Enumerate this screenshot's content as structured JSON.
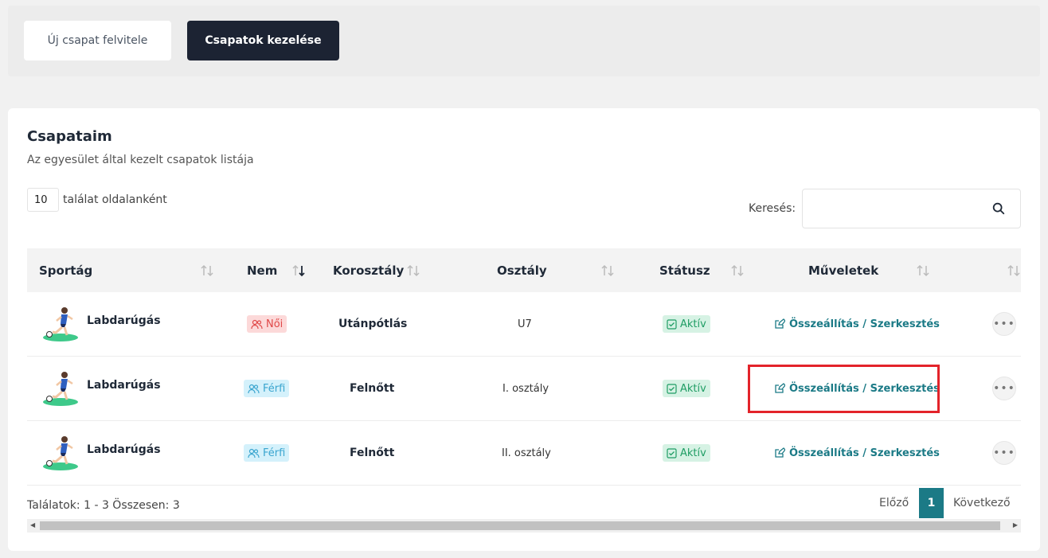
{
  "tabs": {
    "new_team": "Új csapat felvitele",
    "manage_teams": "Csapatok kezelése"
  },
  "card": {
    "title": "Csapataim",
    "subtitle": "Az egyesület által kezelt csapatok listája"
  },
  "table_controls": {
    "per_page_value": "10",
    "per_page_label": "találat oldalanként",
    "search_label": "Keresés:",
    "search_value": ""
  },
  "table": {
    "columns": [
      "Sportág",
      "Nem",
      "Korosztály",
      "Osztály",
      "Státusz",
      "Műveletek"
    ],
    "rows": [
      {
        "sport": "Labdarúgás",
        "gender": "Női",
        "gender_type": "noi",
        "age_group": "Utánpótlás",
        "division": "U7",
        "status": "Aktív",
        "action": "Összeállítás / Szerkesztés"
      },
      {
        "sport": "Labdarúgás",
        "gender": "Férfi",
        "gender_type": "ferfi",
        "age_group": "Felnőtt",
        "division": "I. osztály",
        "status": "Aktív",
        "action": "Összeállítás / Szerkesztés"
      },
      {
        "sport": "Labdarúgás",
        "gender": "Férfi",
        "gender_type": "ferfi",
        "age_group": "Felnőtt",
        "division": "II. osztály",
        "status": "Aktív",
        "action": "Összeállítás / Szerkesztés"
      }
    ]
  },
  "footer": {
    "results_text": "Találatok: 1 - 3 Összesen: 3",
    "prev_label": "Előző",
    "current_page": "1",
    "next_label": "Következő"
  },
  "colors": {
    "accent": "#1b7a86",
    "dark_button": "#1c2333",
    "highlight": "#e3232a"
  }
}
